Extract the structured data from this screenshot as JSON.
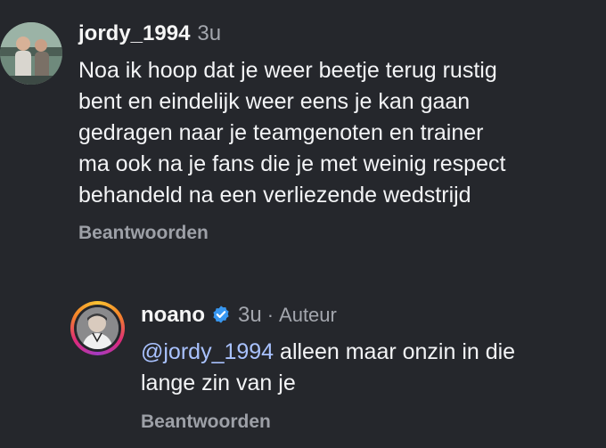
{
  "comment1": {
    "username": "jordy_1994",
    "time": "3u",
    "text": "Noa ik hoop dat je weer beetje terug rustig\nbent en eindelijk weer eens je kan gaan\ngedragen naar je teamgenoten en trainer\nma ook na je fans die je met weinig respect\nbehandeld na een verliezende wedstrijd",
    "reply_label": "Beantwoorden"
  },
  "comment2": {
    "username": "noano",
    "time": "3u",
    "separator": "·",
    "author_label": "Auteur",
    "mention": "@jordy_1994",
    "text": " alleen maar onzin in die\nlange zin van je",
    "reply_label": "Beantwoorden"
  },
  "colors": {
    "background": "#25272c",
    "mention": "#a9c2ff",
    "verified": "#3897f0",
    "muted": "#a3a6ad"
  }
}
